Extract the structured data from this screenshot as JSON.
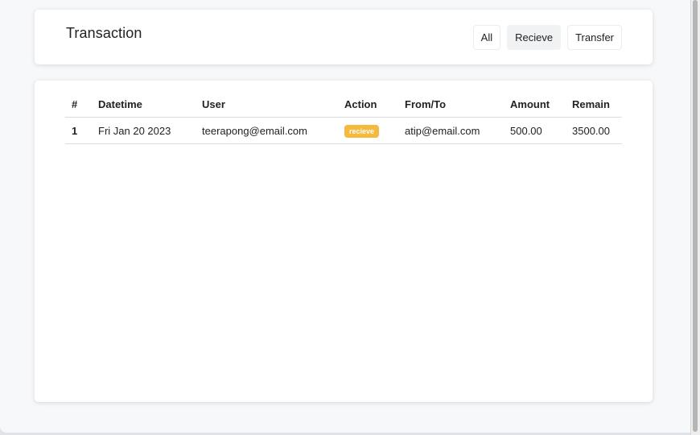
{
  "header": {
    "title": "Transaction",
    "filters": [
      {
        "label": "All",
        "active": false
      },
      {
        "label": "Recieve",
        "active": true
      },
      {
        "label": "Transfer",
        "active": false
      }
    ]
  },
  "table": {
    "columns": [
      "#",
      "Datetime",
      "User",
      "Action",
      "From/To",
      "Amount",
      "Remain"
    ],
    "rows": [
      {
        "index": "1",
        "datetime": "Fri Jan 20 2023",
        "user": "teerapong@email.com",
        "action": "recieve",
        "from_to": "atip@email.com",
        "amount": "500.00",
        "remain": "3500.00"
      }
    ]
  },
  "colors": {
    "badge_recieve": "#f6b93b",
    "active_filter_bg": "#f1f2f3"
  }
}
